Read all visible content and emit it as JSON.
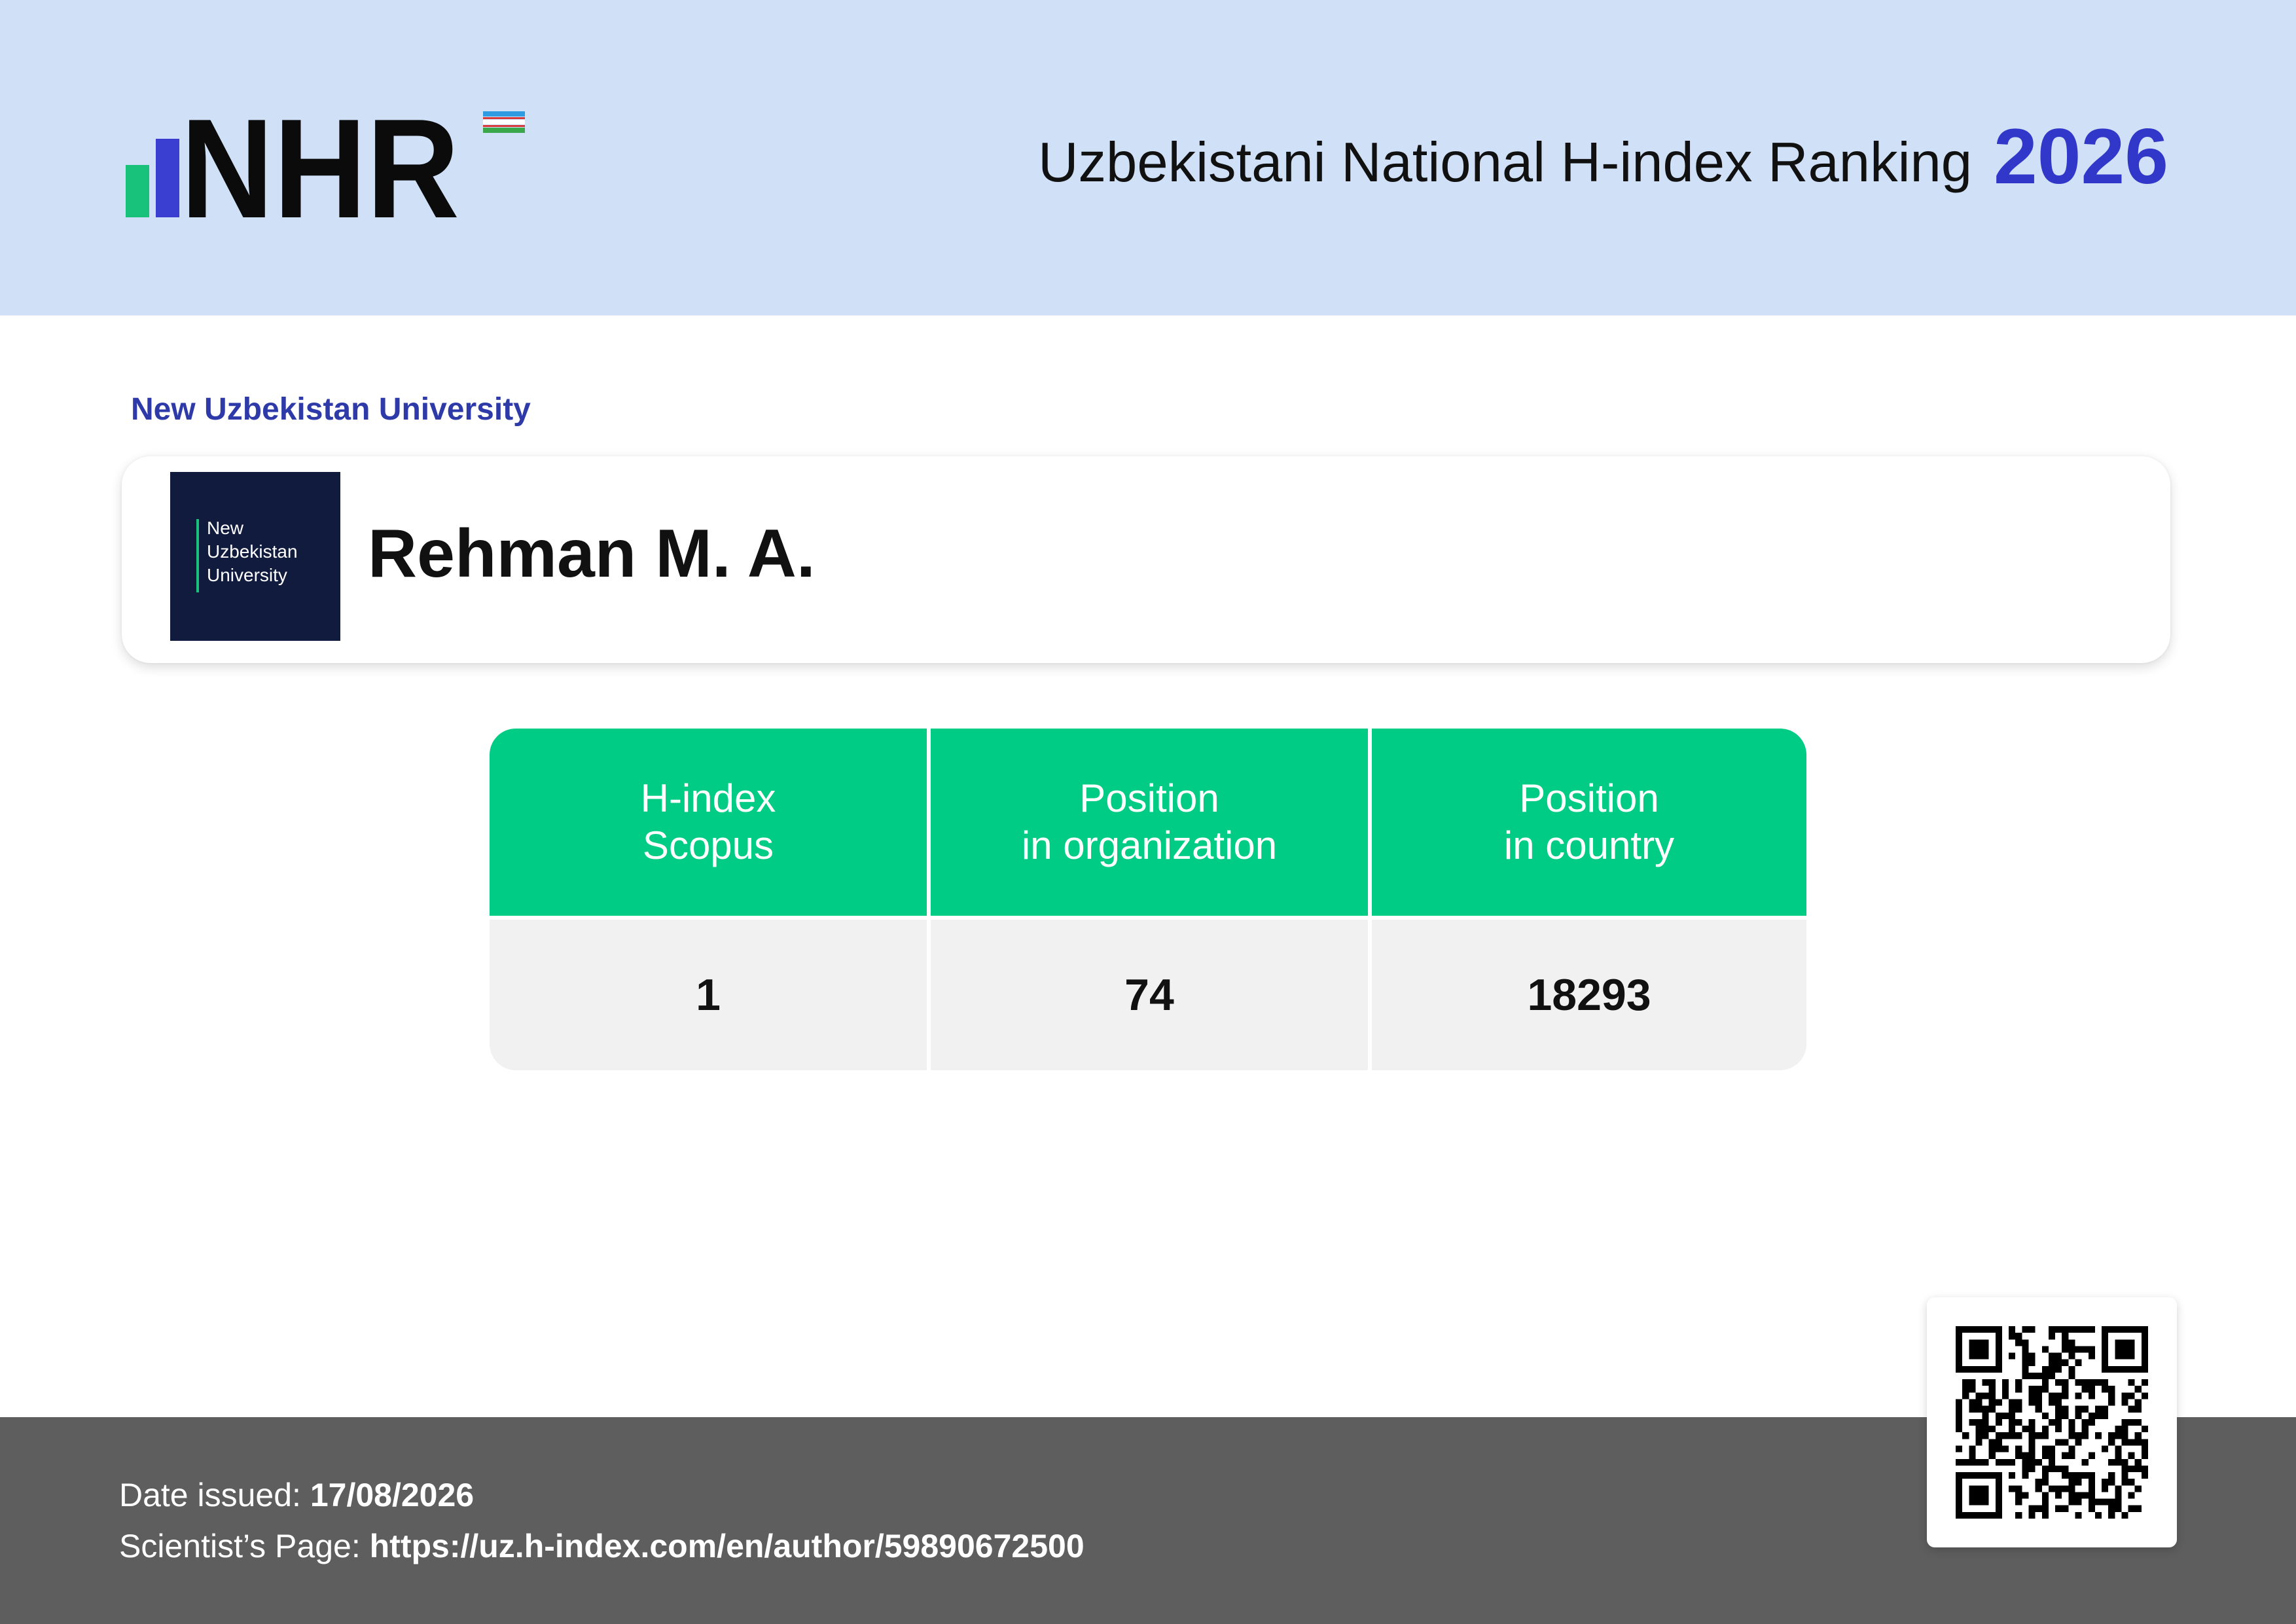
{
  "header": {
    "title": "Uzbekistani National H-index Ranking",
    "year": "2026",
    "logo_text": "NHR",
    "colors": {
      "background": "#cfe0f7",
      "year": "#3137c8",
      "logo_green": "#19c27a",
      "logo_blue": "#3a3ed1"
    }
  },
  "organization": {
    "name": "New Uzbekistan University",
    "logo_lines": [
      "New",
      "Uzbekistan",
      "University"
    ]
  },
  "scientist": {
    "name": "Rehman M. A."
  },
  "stats": {
    "columns": [
      {
        "header_lines": [
          "H-index",
          "Scopus"
        ],
        "value": "1"
      },
      {
        "header_lines": [
          "Position",
          "in organization"
        ],
        "value": "74"
      },
      {
        "header_lines": [
          "Position",
          "in country"
        ],
        "value": "18293"
      }
    ],
    "colors": {
      "header": "#00cc86",
      "cell": "#f1f1f1"
    }
  },
  "footer": {
    "date_label": "Date issued:",
    "date_value": "17/08/2026",
    "page_label": "Scientist’s Page:",
    "page_value": "https://uz.h-index.com/en/author/59890672500"
  },
  "qr": {
    "icon": "qr-code-icon"
  }
}
